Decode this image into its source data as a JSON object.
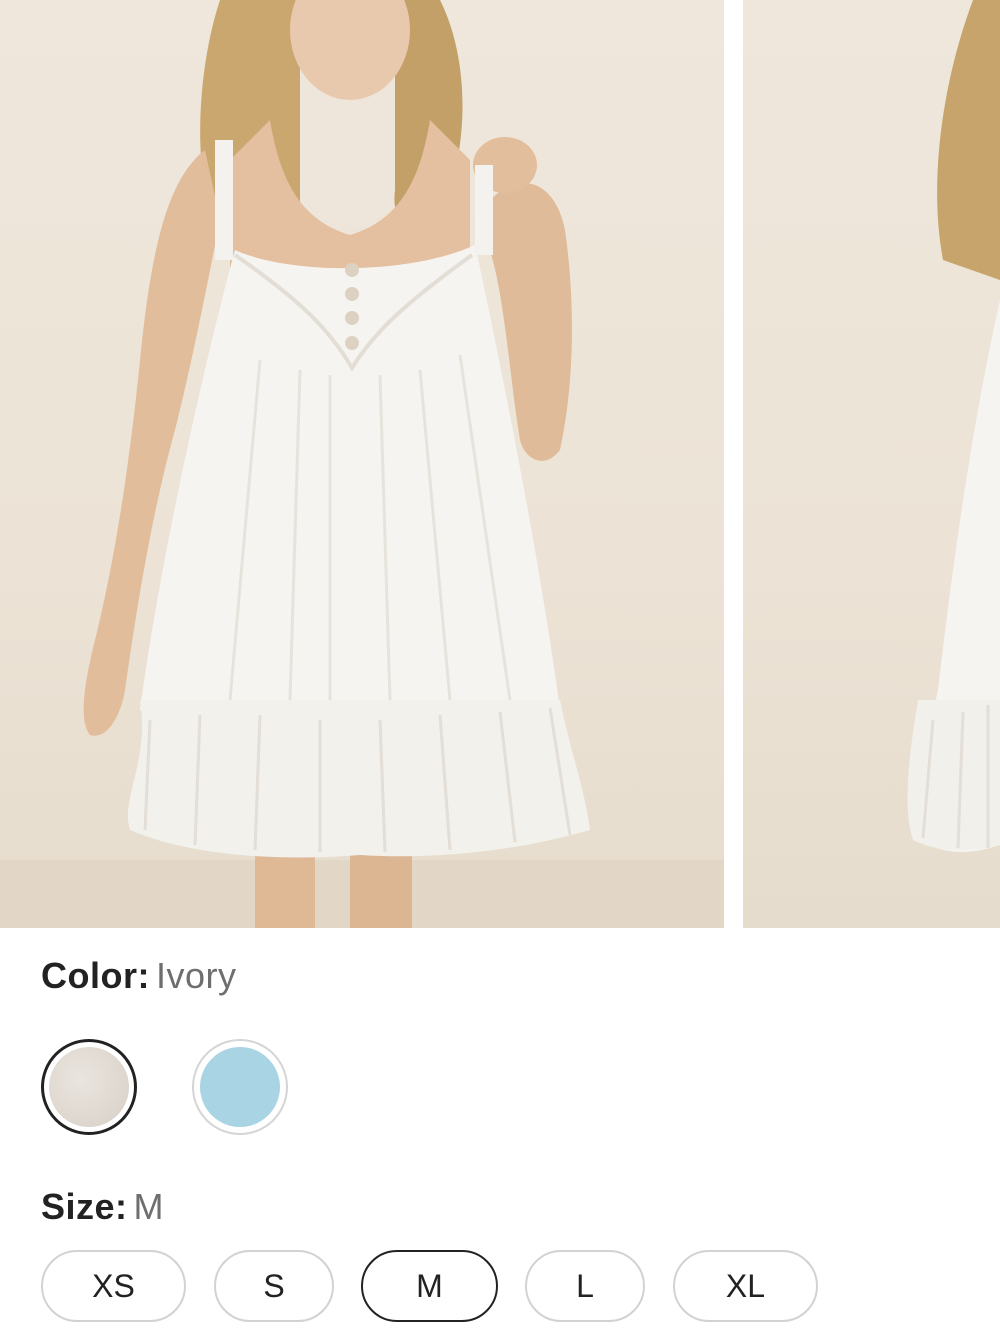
{
  "color": {
    "label": "Color:",
    "value": "Ivory",
    "swatches": [
      {
        "name": "Ivory",
        "hex": "#ddd6ce",
        "selected": true
      },
      {
        "name": "Light Blue",
        "hex": "#a9d4e3",
        "selected": false
      }
    ]
  },
  "size": {
    "label": "Size:",
    "value": "M",
    "options": [
      "XS",
      "S",
      "M",
      "L",
      "XL"
    ],
    "selected": "M"
  },
  "gallery": {
    "images": [
      "product-photo-front",
      "product-photo-side"
    ]
  }
}
